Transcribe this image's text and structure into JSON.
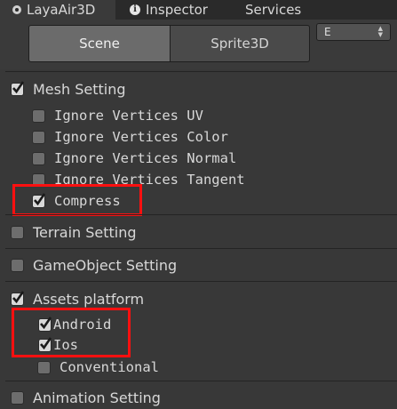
{
  "tabs": [
    {
      "label": "LayaAir3D",
      "icon": "gear-icon"
    },
    {
      "label": "Inspector",
      "icon": "info-icon"
    },
    {
      "label": "Services",
      "icon": ""
    }
  ],
  "toolbar": {
    "scene_label": "Scene",
    "sprite3d_label": "Sprite3D",
    "dropdown_value": "E"
  },
  "mesh_setting": {
    "label": "Mesh Setting",
    "checked": true,
    "options": [
      {
        "label": "Ignore Vertices UV",
        "checked": false
      },
      {
        "label": "Ignore Vertices Color",
        "checked": false
      },
      {
        "label": "Ignore Vertices Normal",
        "checked": false
      },
      {
        "label": "Ignore Vertices Tangent",
        "checked": false
      },
      {
        "label": "Compress",
        "checked": true
      }
    ]
  },
  "terrain_setting": {
    "label": "Terrain Setting",
    "checked": false
  },
  "gameobject_setting": {
    "label": "GameObject Setting",
    "checked": false
  },
  "assets_platform": {
    "label": "Assets platform",
    "checked": true,
    "options": [
      {
        "label": "Android",
        "checked": true
      },
      {
        "label": "Ios",
        "checked": true
      },
      {
        "label": "Conventional",
        "checked": false
      }
    ]
  },
  "animation_setting": {
    "label": "Animation Setting",
    "checked": false
  },
  "colors": {
    "background": "#383838",
    "highlight": "#ff1010",
    "text": "#d8d8d8"
  }
}
